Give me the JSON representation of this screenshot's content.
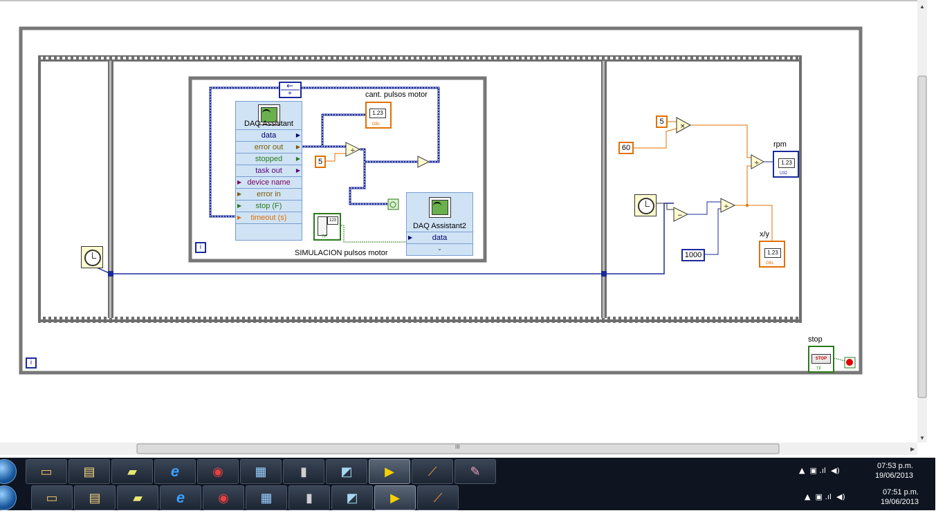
{
  "diagram": {
    "daq1": {
      "title": "DAQ Assistant",
      "rows": [
        "data",
        "error out",
        "stopped",
        "task out",
        "device name",
        "error in",
        "stop (F)",
        "timeout (s)"
      ],
      "row_colors": [
        "#00006a",
        "#7a5a00",
        "#2a7a1a",
        "#5a007a",
        "#7a005a",
        "#7a5a00",
        "#2a7a1a",
        "#e07000"
      ]
    },
    "daq2": {
      "title": "DAQ Assistant2",
      "row": "data"
    },
    "cant_pulsos_label": "cant. pulsos motor",
    "indicator_dbl": "1.23",
    "indicator_dbl_tag": "DBL",
    "indicator_u32_tag": "U32",
    "const_5_a": "5",
    "const_5_b": "5",
    "const_60": "60",
    "const_1000": "1000",
    "inner_loop_label": "SIMULACION pulsos motor",
    "loop_iter": "i",
    "rpm_label": "rpm",
    "xy_label": "x/y",
    "stop_label": "stop",
    "stop_button_text": "STOP",
    "tf_tag": "TF",
    "mult_symbol": "×",
    "div_symbol": "÷",
    "minus_symbol": "−",
    "scroll_grip": "III"
  },
  "taskbar_rows": [
    {
      "time": "07:53 p.m.",
      "date": "19/06/2013"
    },
    {
      "time": "07:51 p.m.",
      "date": "19/06/2013"
    }
  ],
  "taskbar_icons": [
    "start-orb",
    "remote-desktop",
    "explorer",
    "sticky-notes",
    "internet-explorer",
    "chrome",
    "calculator",
    "device-server",
    "notepad",
    "labview",
    "analytics",
    "paint"
  ],
  "colors": {
    "numeric_orange": "#e07000",
    "wire_blue": "#1a2a9a",
    "boolean_green": "#2a7a1a",
    "frame_gray": "#6e6e6e",
    "taskbar": "#0e1520"
  }
}
